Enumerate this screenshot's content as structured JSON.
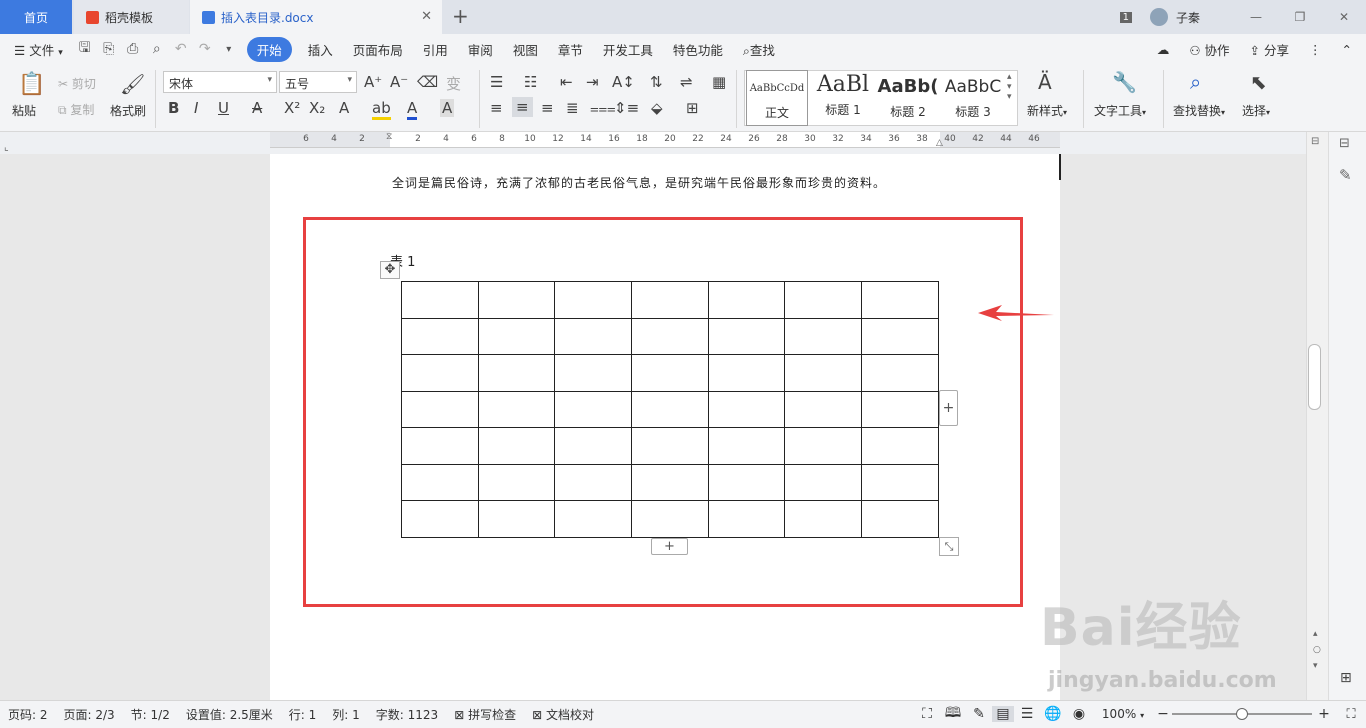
{
  "titlebar": {
    "tab_home": "首页",
    "tab_docer": "稻壳模板",
    "tab_doc": "插入表目录.docx",
    "window_badge": "1",
    "user_name": "子秦"
  },
  "menubar": {
    "file": "文件",
    "items": [
      "开始",
      "插入",
      "页面布局",
      "引用",
      "审阅",
      "视图",
      "章节",
      "开发工具",
      "特色功能"
    ],
    "search": "查找",
    "collab": "协作",
    "share": "分享"
  },
  "ribbon": {
    "paste": "粘贴",
    "cut": "剪切",
    "copy": "复制",
    "format_painter": "格式刷",
    "font_name": "宋体",
    "font_size": "五号",
    "styles": [
      {
        "preview": "AaBbCcDd",
        "label": "正文"
      },
      {
        "preview": "AaBl",
        "label": "标题 1"
      },
      {
        "preview": "AaBb(",
        "label": "标题 2"
      },
      {
        "preview": "AaBbC",
        "label": "标题 3"
      }
    ],
    "new_style": "新样式",
    "text_tools": "文字工具",
    "find_replace": "查找替换",
    "select": "选择"
  },
  "ruler_ticks": [
    "6",
    "4",
    "2",
    "",
    "2",
    "4",
    "6",
    "8",
    "10",
    "12",
    "14",
    "16",
    "18",
    "20",
    "22",
    "24",
    "26",
    "28",
    "30",
    "32",
    "34",
    "36",
    "38",
    "40",
    "42",
    "44",
    "46"
  ],
  "document": {
    "body_text": "全词是篇民俗诗，充满了浓郁的古老民俗气息，是研究端午民俗最形象而珍贵的资料。",
    "caption": "表 1",
    "table_rows": 7,
    "table_cols": 7
  },
  "statusbar": {
    "page_num": "页码: 2",
    "pages": "页面: 2/3",
    "section": "节: 1/2",
    "setting": "设置值: 2.5厘米",
    "row": "行: 1",
    "col": "列: 1",
    "word_count": "字数: 1123",
    "spell_check": "拼写检查",
    "doc_check": "文档校对",
    "zoom": "100%"
  },
  "watermark": {
    "main": "Bai经验",
    "sub": "jingyan.baidu.com"
  },
  "colors": {
    "accent": "#3d7ae0",
    "highlight": "#e74040"
  }
}
